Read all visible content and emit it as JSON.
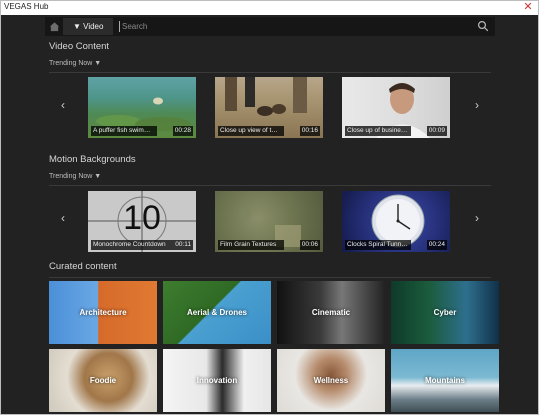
{
  "window": {
    "title": "VEGAS Hub",
    "close_symbol": "✕"
  },
  "topbar": {
    "tab_label": "▼ Video",
    "search_placeholder": "Search"
  },
  "video_content": {
    "title": "Video Content",
    "filter": "Trending Now ▼",
    "items": [
      {
        "caption": "A puffer fish swim…",
        "duration": "00:28"
      },
      {
        "caption": "Close up view of t…",
        "duration": "00:16"
      },
      {
        "caption": "Close up of busine…",
        "duration": "00:09"
      }
    ]
  },
  "motion_backgrounds": {
    "title": "Motion Backgrounds",
    "filter": "Trending Now ▼",
    "items": [
      {
        "caption": "Monochrome Countdown",
        "duration": "00:11",
        "overlay": "10"
      },
      {
        "caption": "Film Grain Textures",
        "duration": "00:06"
      },
      {
        "caption": "Clocks Spiral Tunn…",
        "duration": "00:24"
      }
    ]
  },
  "curated": {
    "title": "Curated content",
    "tiles": [
      {
        "label": "Architecture"
      },
      {
        "label": "Aerial & Drones"
      },
      {
        "label": "Cinematic"
      },
      {
        "label": "Cyber"
      },
      {
        "label": "Foodie"
      },
      {
        "label": "Innovation"
      },
      {
        "label": "Wellness"
      },
      {
        "label": "Mountains"
      }
    ]
  },
  "nav": {
    "prev": "‹",
    "next": "›"
  }
}
